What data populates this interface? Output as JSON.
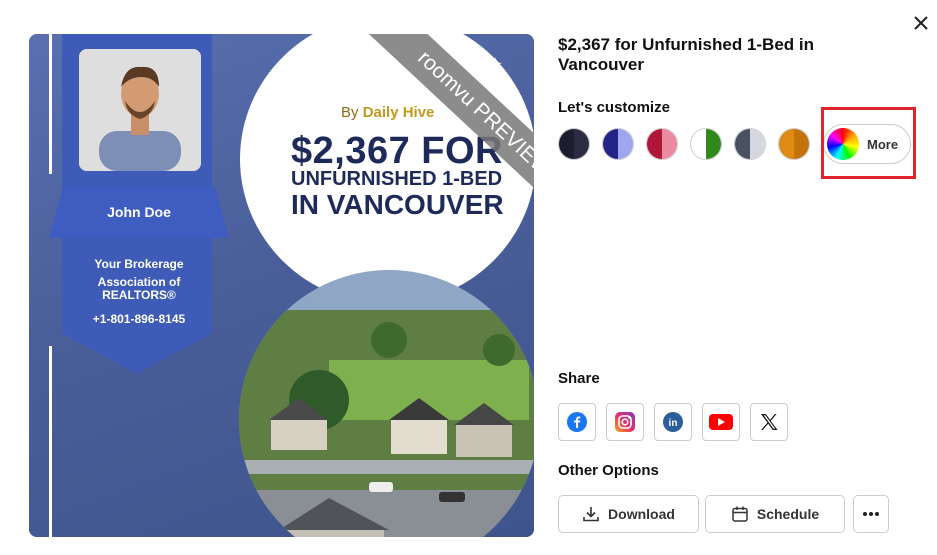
{
  "dialog": {
    "close_icon": "close-icon"
  },
  "preview": {
    "agent_name": "John Doe",
    "brokerage_line1": "Your Brokerage",
    "brokerage_line2": "Association of",
    "brokerage_line3": "REALTORS®",
    "phone": "+1-801-896-8145",
    "byline_prefix": "By ",
    "byline_brand": "Daily Hive",
    "headline_line1": "$2,367 FOR",
    "headline_line2": "UNFURNISHED 1-BED",
    "headline_line3": "IN VANCOUVER",
    "watermark": "roomvu PREVIEW"
  },
  "panel": {
    "title": "$2,367 for Unfurnished 1-Bed in Vancouver",
    "customize_label": "Let's customize",
    "more_label": "More",
    "share_label": "Share",
    "other_options_label": "Other Options",
    "download_label": "Download",
    "schedule_label": "Schedule"
  },
  "swatches": [
    {
      "left": "#1c1d2e",
      "right": "#2b2c44"
    },
    {
      "left": "#23238a",
      "right": "#9ea6ee"
    },
    {
      "left": "#b0163a",
      "right": "#e88aa0"
    },
    {
      "left": "#ffffff",
      "right": "#2f8a1a"
    },
    {
      "left": "#4a5163",
      "right": "#d6d8e0"
    },
    {
      "left": "#e08a12",
      "right": "#c4720a"
    }
  ],
  "share_icons": [
    "facebook-icon",
    "instagram-icon",
    "linkedin-icon",
    "youtube-icon",
    "x-icon"
  ],
  "colors": {
    "accent_red": "#e0242c",
    "card_blue": "#4a5f9a"
  }
}
